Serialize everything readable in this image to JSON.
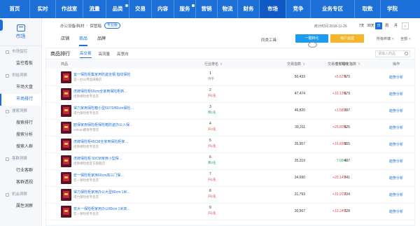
{
  "top_nav": {
    "items": [
      {
        "label": "首页",
        "badge": false,
        "active": false
      },
      {
        "label": "实时",
        "badge": false,
        "active": false
      },
      {
        "label": "作战室",
        "badge": false,
        "active": false
      },
      {
        "label": "流量",
        "badge": false,
        "active": false
      },
      {
        "label": "品类",
        "badge": true,
        "active": false
      },
      {
        "label": "交易",
        "badge": false,
        "active": false
      },
      {
        "label": "内容",
        "badge": false,
        "active": false
      },
      {
        "label": "服务",
        "badge": true,
        "active": false
      },
      {
        "label": "营销",
        "badge": false,
        "active": false
      },
      {
        "label": "物流",
        "badge": false,
        "active": false
      },
      {
        "label": "财务",
        "badge": false,
        "active": false
      },
      {
        "label": "市场",
        "badge": false,
        "active": true
      },
      {
        "label": "竞争",
        "badge": false,
        "active": false
      },
      {
        "label": "业务专区",
        "badge": false,
        "active": false
      },
      {
        "label": "取数",
        "badge": false,
        "active": false
      },
      {
        "label": "学院",
        "badge": false,
        "active": false
      }
    ],
    "colors": {
      "bar": "#1d6fd8",
      "active": "#0f5ac4"
    }
  },
  "sidebar": {
    "title": "市场",
    "groups": [
      {
        "label": "市场监控",
        "items": [
          "监控看板"
        ]
      },
      {
        "label": "供给洞察",
        "items": [
          "市场大盘",
          "市场排行"
        ]
      },
      {
        "label": "搜索洞察",
        "items": [
          "搜索排行",
          "搜索分析",
          "搜索人群"
        ]
      },
      {
        "label": "客群洞察",
        "items": [
          "行业客群",
          "客群透视"
        ]
      },
      {
        "label": "机会洞察",
        "items": [
          "属性洞察"
        ]
      }
    ],
    "active_item": "市场排行"
  },
  "filter_bar": {
    "breadcrumb": [
      "办公设备/耗材",
      "保管箱"
    ],
    "breadcrumb_badge": "专业版",
    "stat_time": "统计时间 2018-11-26",
    "periods": [
      "7天",
      "30天",
      "日",
      "周",
      "月"
    ],
    "period_icon": "<"
  },
  "sub_tabs": [
    "店铺",
    "商品",
    "品牌"
  ],
  "active_sub_tab": "商品",
  "tools": {
    "label": "同类工具:",
    "compare_button": "一键转化",
    "user_button": "用户运营",
    "dropdown1": "所有终端",
    "dropdown2": "全部"
  },
  "card": {
    "title": "商品排行",
    "tabs": [
      "高交易",
      "高流量",
      "高意向"
    ],
    "active_tab": "高交易",
    "search_placeholder": "请输入商品",
    "columns": [
      "商品",
      "行业排名",
      "交易指数",
      "交易增长幅度",
      "支付转化指数",
      "操作"
    ],
    "rows": [
      {
        "name": "宜一保险柜集家用防盗全钢 指纹保险",
        "shop": "宜一办公用品旗舰店",
        "rank": "1",
        "change": "持平",
        "dir": "flat",
        "trade": "50,433",
        "growth": "+5.62%",
        "conv": "570",
        "op": "趋势分析"
      },
      {
        "name": "虎牌保险柜60cm全家用保险柜新…",
        "shop": "虎牌保险柜专卖店",
        "rank": "2",
        "change": "升1名",
        "dir": "up",
        "trade": "47,474",
        "growth": "+10.13%",
        "conv": "679",
        "op": "趋势分析"
      },
      {
        "name": "得力家用保险箱小型60/70/80cm保险…",
        "shop": "得力保险柜专卖店",
        "rank": "3",
        "change": "降1名",
        "dir": "down",
        "trade": "46,820",
        "growth": "+1.58%",
        "conv": "787",
        "op": "趋势分析"
      },
      {
        "name": "欧保家用保险柜保险箱防盗办公入保…",
        "shop": "ombao都保专营店",
        "rank": "4",
        "change": "升2名",
        "dir": "up",
        "trade": "39,311",
        "growth": "+29.80%",
        "conv": "625",
        "op": "趋势分析"
      },
      {
        "name": "虎牌保险柜45CM全家用保险柜家…",
        "shop": "虎牌保险柜专卖店",
        "rank": "5",
        "change": "升1名",
        "dir": "up",
        "trade": "35,957",
        "growth": "+16.89%",
        "conv": "555",
        "op": "趋势分析"
      },
      {
        "name": "虎牌保险柜 60CM家用小型保…",
        "shop": "虎牌保险柜官方旗舰店",
        "rank": "6",
        "change": "降2名",
        "dir": "down",
        "trade": "35,219",
        "growth": "-7.66%",
        "conv": "487",
        "op": "趋势分析"
      },
      {
        "name": "宏一保险柜家用60cm高三门保…",
        "shop": "宏一保险柜专卖店",
        "rank": "7",
        "change": "升1名",
        "dir": "up",
        "trade": "34,690",
        "growth": "+20.14%",
        "conv": "741",
        "op": "趋势分析"
      },
      {
        "name": "得力保险柜家用办公大型80cm 1米…",
        "shop": "得力保险柜专卖店",
        "rank": "8",
        "change": "升1名",
        "dir": "up",
        "trade": "31,793",
        "growth": "+15.91%",
        "conv": "734",
        "op": "趋势分析"
      },
      {
        "name": "宏大一保险柜家用办公80cm 1米高…",
        "shop": "宏一保险柜专卖店",
        "rank": "9",
        "change": "升1名",
        "dir": "up",
        "trade": "30,567",
        "growth": "+13.24%",
        "conv": "728",
        "op": "趋势分析"
      }
    ]
  }
}
